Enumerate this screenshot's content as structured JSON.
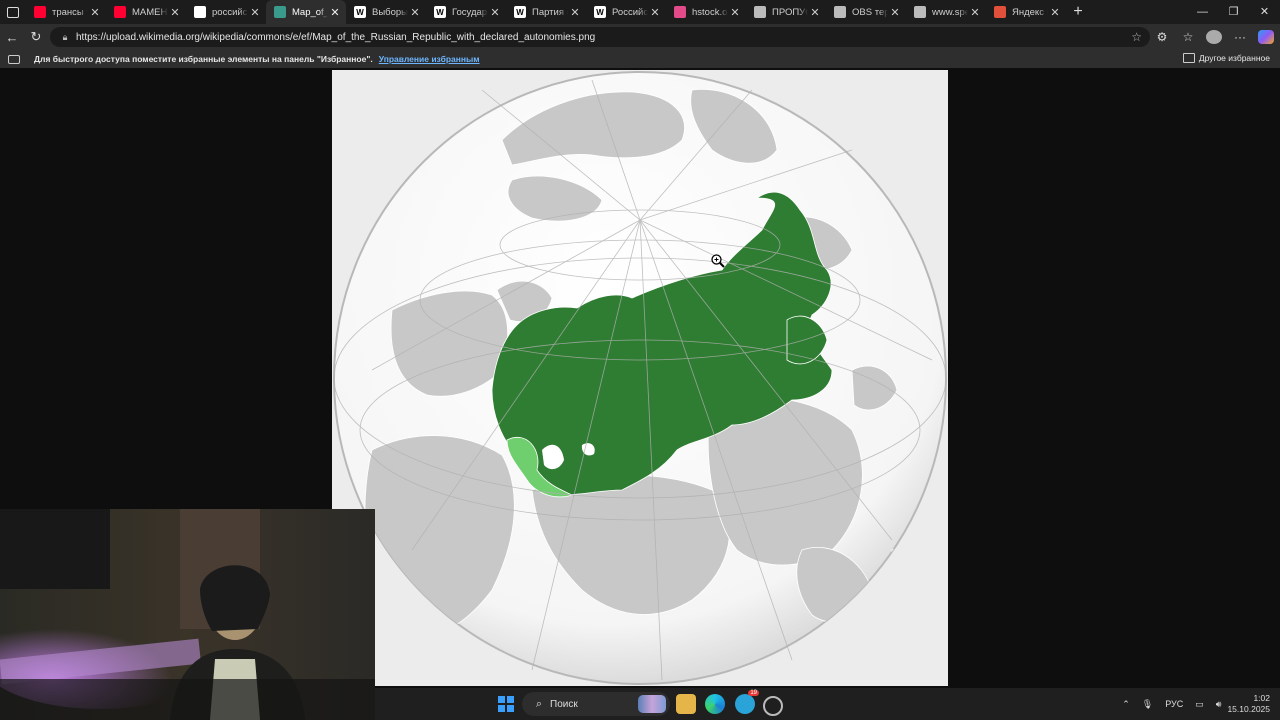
{
  "tabs": [
    {
      "title": "трансы тохо",
      "icon": "youtube-icon",
      "color": "#ff0033",
      "active": false
    },
    {
      "title": "МАМЕНЬКИ",
      "icon": "youtube-icon",
      "color": "#ff0033",
      "active": false
    },
    {
      "title": "российская",
      "icon": "google-icon",
      "color": "#ffffff",
      "active": false
    },
    {
      "title": "Map_of_the_",
      "icon": "wikimedia-icon",
      "color": "#3a9b8c",
      "active": true
    },
    {
      "title": "Выборы во",
      "icon": "wikipedia-icon",
      "color": "#ffffff",
      "active": false
    },
    {
      "title": "Государстве",
      "icon": "wikipedia-icon",
      "color": "#ffffff",
      "active": false
    },
    {
      "title": "Партия соц",
      "icon": "wikipedia-icon",
      "color": "#ffffff",
      "active": false
    },
    {
      "title": "Российская",
      "icon": "wikipedia-icon",
      "color": "#ffffff",
      "active": false
    },
    {
      "title": "hstock.org/",
      "icon": "hstock-icon",
      "color": "#e24a8a",
      "active": false
    },
    {
      "title": "ПРОПУСК",
      "icon": "globe-icon",
      "color": "#bbbbbb",
      "active": false
    },
    {
      "title": "OBS теряет",
      "icon": "globe-icon",
      "color": "#bbbbbb",
      "active": false
    },
    {
      "title": "www.speedt",
      "icon": "page-icon",
      "color": "#bbbbbb",
      "active": false
    },
    {
      "title": "Яндекс Инт",
      "icon": "yandex-icon",
      "color": "#e0503a",
      "active": false
    }
  ],
  "address": {
    "url": "https://upload.wikimedia.org/wikipedia/commons/e/ef/Map_of_the_Russian_Republic_with_declared_autonomies.png"
  },
  "favorites": {
    "message": "Для быстрого доступа поместите избранные элементы на панель \"Избранное\".",
    "manage_link": "Управление избранным",
    "other_label": "Другое избранное"
  },
  "map": {
    "water_color": "#ffffff",
    "land_color": "#c8c8c8",
    "republic_color": "#2f7d32",
    "autonomy_color": "#6fcf6f"
  },
  "taskbar": {
    "search_placeholder": "Поиск",
    "language": "РУС",
    "time": "1:02",
    "date": "15.10.2025",
    "edge_badge": "19"
  }
}
